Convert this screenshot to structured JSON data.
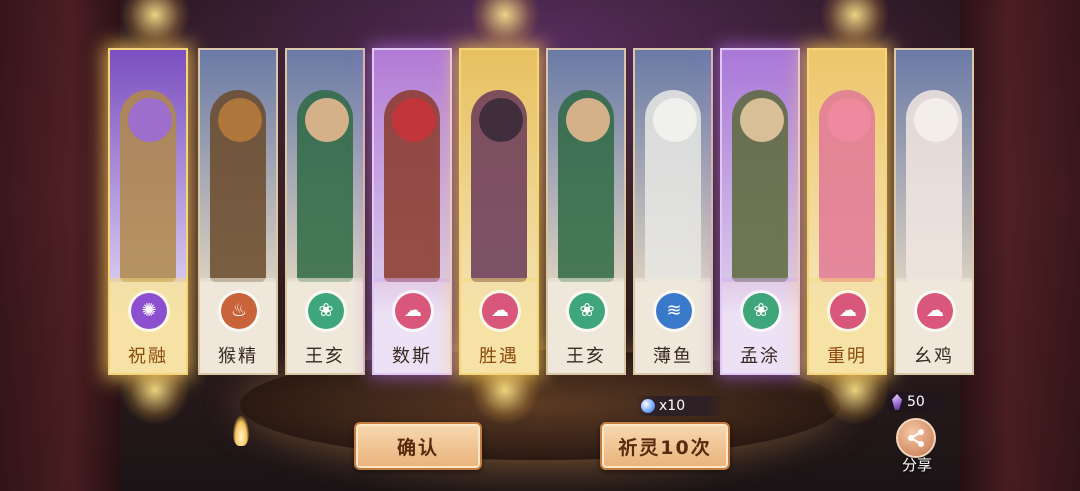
{
  "cards": [
    {
      "name": "祝融",
      "rarity": "gold",
      "emblem_icon": "flame-element-icon",
      "emblem_color": "#8b4fd0",
      "art_top": "#7a4fc0",
      "art_bottom": "#d6c7ee",
      "head_color": "#9b6cd8",
      "body_color": "#b08a4a"
    },
    {
      "name": "猴精",
      "rarity": "normal",
      "emblem_icon": "fire-element-icon",
      "emblem_color": "#c9643a",
      "art_top": "#6a7aa6",
      "art_bottom": "#d9d0c0",
      "head_color": "#b57a3a",
      "body_color": "#6a4a2a"
    },
    {
      "name": "王亥",
      "rarity": "normal",
      "emblem_icon": "wood-element-icon",
      "emblem_color": "#3fa57a",
      "art_top": "#6a7aa6",
      "art_bottom": "#d9d0c0",
      "head_color": "#e6b890",
      "body_color": "#2f6a44"
    },
    {
      "name": "数斯",
      "rarity": "purple",
      "emblem_icon": "cloud-element-icon",
      "emblem_color": "#d8577a",
      "art_top": "#b27bd6",
      "art_bottom": "#d8c6ea",
      "head_color": "#c8333a",
      "body_color": "#8a3a2a"
    },
    {
      "name": "胜遇",
      "rarity": "gold",
      "emblem_icon": "cloud-element-icon",
      "emblem_color": "#d8577a",
      "art_top": "#e8c060",
      "art_bottom": "#f1e0a8",
      "head_color": "#3a2a3a",
      "body_color": "#6a3a5a"
    },
    {
      "name": "王亥",
      "rarity": "normal",
      "emblem_icon": "wood-element-icon",
      "emblem_color": "#3fa57a",
      "art_top": "#6a7aa6",
      "art_bottom": "#d9d0c0",
      "head_color": "#e6b890",
      "body_color": "#2f6a44"
    },
    {
      "name": "薄鱼",
      "rarity": "normal",
      "emblem_icon": "water-element-icon",
      "emblem_color": "#3a78c9",
      "art_top": "#6a7aa6",
      "art_bottom": "#d9d0c0",
      "head_color": "#f2f2ee",
      "body_color": "#e8e8e4"
    },
    {
      "name": "孟涂",
      "rarity": "purple",
      "emblem_icon": "wood-element-icon",
      "emblem_color": "#3fa57a",
      "art_top": "#a978d8",
      "art_bottom": "#d8c6ea",
      "head_color": "#e6c8a0",
      "body_color": "#5a6a3a"
    },
    {
      "name": "重明",
      "rarity": "gold",
      "emblem_icon": "cloud-element-icon",
      "emblem_color": "#d8577a",
      "art_top": "#eec56a",
      "art_bottom": "#f4e2b0",
      "head_color": "#f08aa0",
      "body_color": "#e07898"
    },
    {
      "name": "幺鸡",
      "rarity": "normal",
      "emblem_icon": "cloud-element-icon",
      "emblem_color": "#d8577a",
      "art_top": "#6a7aa6",
      "art_bottom": "#d9d0c0",
      "head_color": "#f4f0ea",
      "body_color": "#f2e6e0"
    }
  ],
  "buttons": {
    "confirm_label": "确认",
    "draw_ten_label": "祈灵10次"
  },
  "draw_cost": "x10",
  "crystal_count": "50",
  "share_label": "分享"
}
